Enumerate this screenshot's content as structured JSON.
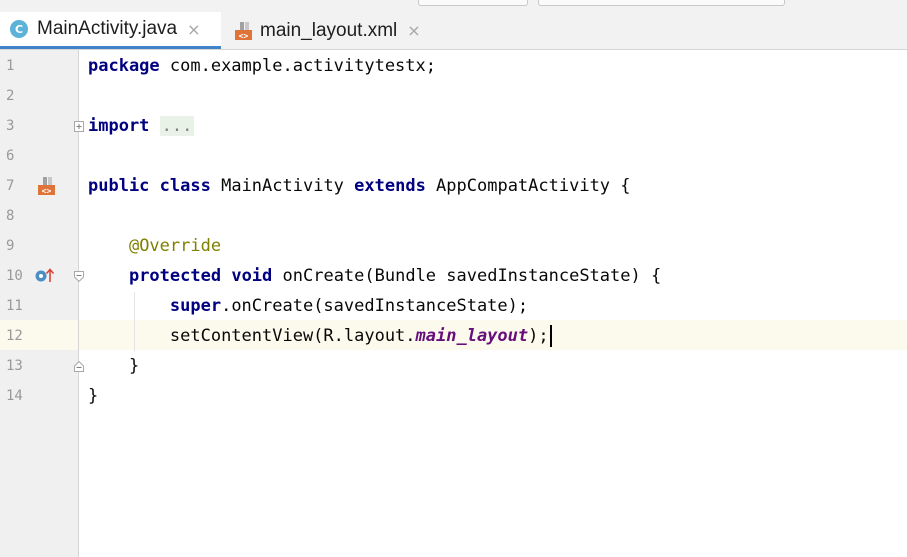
{
  "tabs": [
    {
      "label": "MainActivity.java",
      "icon": "class-icon",
      "icon_letter": "C",
      "active": true,
      "close": "×"
    },
    {
      "label": "main_layout.xml",
      "icon": "xml-layout-icon",
      "active": false,
      "close": "×"
    }
  ],
  "line_numbers": [
    "1",
    "2",
    "3",
    "6",
    "7",
    "8",
    "9",
    "10",
    "11",
    "12",
    "13",
    "14"
  ],
  "code": {
    "l1_kw": "package",
    "l1_rest": " com.example.activitytestx;",
    "l3_kw": "import",
    "l3_fold": "...",
    "l7_kw1": "public",
    "l7_kw2": "class",
    "l7_name": " MainActivity ",
    "l7_kw3": "extends",
    "l7_rest": " AppCompatActivity {",
    "l9_ann": "@Override",
    "l10_kw1": "protected",
    "l10_kw2": "void",
    "l10_rest": " onCreate(Bundle savedInstanceState) {",
    "l11_kw": "super",
    "l11_rest": ".onCreate(savedInstanceState);",
    "l12_pre": "setContentView(R.layout.",
    "l12_field": "main_layout",
    "l12_post": ");",
    "l13": "}",
    "l14": "}"
  },
  "colors": {
    "keyword": "#000080",
    "annotation": "#808000",
    "field": "#660e7a",
    "current_line": "#fcfaed",
    "tab_underline": "#4083c9",
    "class_icon": "#5cb2d8"
  }
}
